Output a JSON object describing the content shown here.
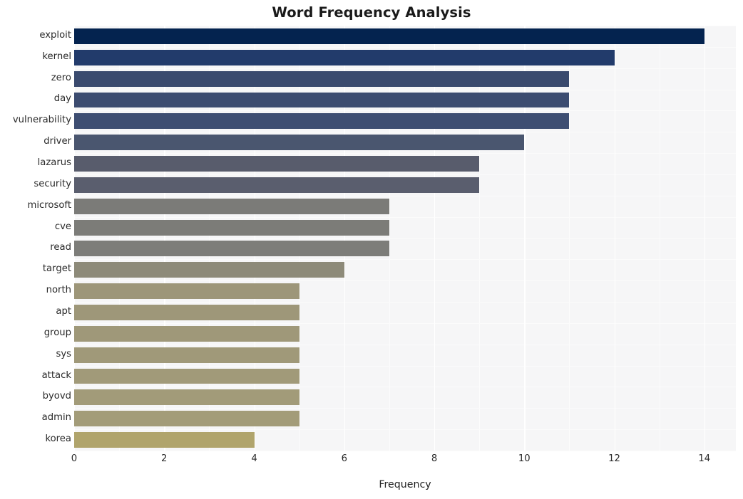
{
  "chart_data": {
    "type": "bar",
    "orientation": "horizontal",
    "title": "Word Frequency Analysis",
    "xlabel": "Frequency",
    "ylabel": "",
    "categories": [
      "exploit",
      "kernel",
      "zero",
      "day",
      "vulnerability",
      "driver",
      "lazarus",
      "security",
      "microsoft",
      "cve",
      "read",
      "target",
      "north",
      "apt",
      "group",
      "sys",
      "attack",
      "byovd",
      "admin",
      "korea"
    ],
    "values": [
      14,
      12,
      11,
      11,
      11,
      10,
      9,
      9,
      7,
      7,
      7,
      6,
      5,
      5,
      5,
      5,
      5,
      5,
      5,
      4
    ],
    "xlim": [
      0,
      14.7
    ],
    "xticks": [
      0,
      2,
      4,
      6,
      8,
      10,
      12,
      14
    ],
    "xtick_labels": [
      "0",
      "2",
      "4",
      "6",
      "8",
      "10",
      "12",
      "14"
    ],
    "grid": true,
    "grid_axis": "x",
    "legend": false,
    "colormap": "cividis",
    "bar_colors": [
      "#04234f",
      "#223b6b",
      "#3a4a6e",
      "#3c4c70",
      "#3e4e72",
      "#4a566f",
      "#585c6c",
      "#5a5e6e",
      "#7b7b78",
      "#7c7c78",
      "#7d7d79",
      "#8d8a79",
      "#9d9679",
      "#9e9779",
      "#9f9879",
      "#a09979",
      "#a19a79",
      "#a29b79",
      "#a39c79",
      "#b0a46c"
    ],
    "plot_background": "#f6f6f7",
    "figure_background": "#ffffff",
    "grid_color": "#ffffff"
  },
  "title": "Word Frequency Analysis",
  "axes": {
    "x_axis_label": "Frequency",
    "x_tick_labels": [
      "0",
      "2",
      "4",
      "6",
      "8",
      "10",
      "12",
      "14"
    ],
    "y_tick_labels": [
      "exploit",
      "kernel",
      "zero",
      "day",
      "vulnerability",
      "driver",
      "lazarus",
      "security",
      "microsoft",
      "cve",
      "read",
      "target",
      "north",
      "apt",
      "group",
      "sys",
      "attack",
      "byovd",
      "admin",
      "korea"
    ]
  }
}
